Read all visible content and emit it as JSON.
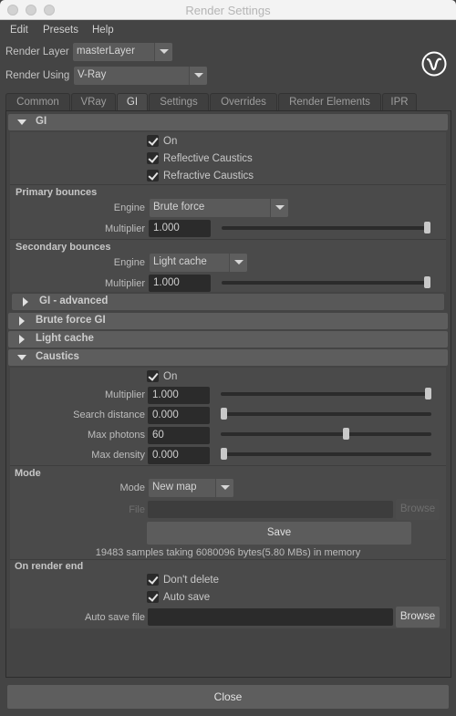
{
  "window": {
    "title": "Render Settings"
  },
  "menu": [
    "Edit",
    "Presets",
    "Help"
  ],
  "render_layer": {
    "label": "Render Layer",
    "value": "masterLayer"
  },
  "render_using": {
    "label": "Render Using",
    "value": "V-Ray"
  },
  "logo": "vray-logo-icon",
  "tabs": [
    {
      "label": "Common",
      "active": false
    },
    {
      "label": "VRay",
      "active": false
    },
    {
      "label": "GI",
      "active": true
    },
    {
      "label": "Settings",
      "active": false
    },
    {
      "label": "Overrides",
      "active": false
    },
    {
      "label": "Render Elements",
      "active": false
    },
    {
      "label": "IPR",
      "active": false
    }
  ],
  "gi": {
    "title": "GI",
    "expanded": true,
    "checkboxes": [
      {
        "label": "On",
        "checked": true
      },
      {
        "label": "Reflective Caustics",
        "checked": true
      },
      {
        "label": "Refractive Caustics",
        "checked": true
      }
    ],
    "primary": {
      "header": "Primary bounces",
      "engine_label": "Engine",
      "engine_value": "Brute force",
      "multiplier_label": "Multiplier",
      "multiplier_value": "1.000",
      "multiplier_slider": 1.0
    },
    "secondary": {
      "header": "Secondary bounces",
      "engine_label": "Engine",
      "engine_value": "Light cache",
      "multiplier_label": "Multiplier",
      "multiplier_value": "1.000",
      "multiplier_slider": 1.0
    },
    "advanced": {
      "title": "GI - advanced",
      "expanded": false
    }
  },
  "brute_force": {
    "title": "Brute force GI",
    "expanded": false
  },
  "light_cache": {
    "title": "Light cache",
    "expanded": false
  },
  "caustics": {
    "title": "Caustics",
    "expanded": true,
    "on": {
      "label": "On",
      "checked": true
    },
    "fields": [
      {
        "label": "Multiplier",
        "value": "1.000",
        "slider": 1.0
      },
      {
        "label": "Search distance",
        "value": "0.000",
        "slider": 0.0
      },
      {
        "label": "Max photons",
        "value": "60",
        "slider": 0.6
      },
      {
        "label": "Max density",
        "value": "0.000",
        "slider": 0.0
      }
    ],
    "mode": {
      "header": "Mode",
      "mode_label": "Mode",
      "mode_value": "New map",
      "file_label": "File",
      "file_value": "",
      "browse_label": "Browse",
      "save_label": "Save",
      "info": "19483 samples taking 6080096 bytes(5.80 MBs) in memory"
    },
    "on_render_end": {
      "header": "On render end",
      "dont_delete": {
        "label": "Don't delete",
        "checked": true
      },
      "auto_save": {
        "label": "Auto save",
        "checked": true
      },
      "auto_save_file_label": "Auto save file",
      "auto_save_file_value": "",
      "browse_label": "Browse"
    }
  },
  "close_label": "Close"
}
